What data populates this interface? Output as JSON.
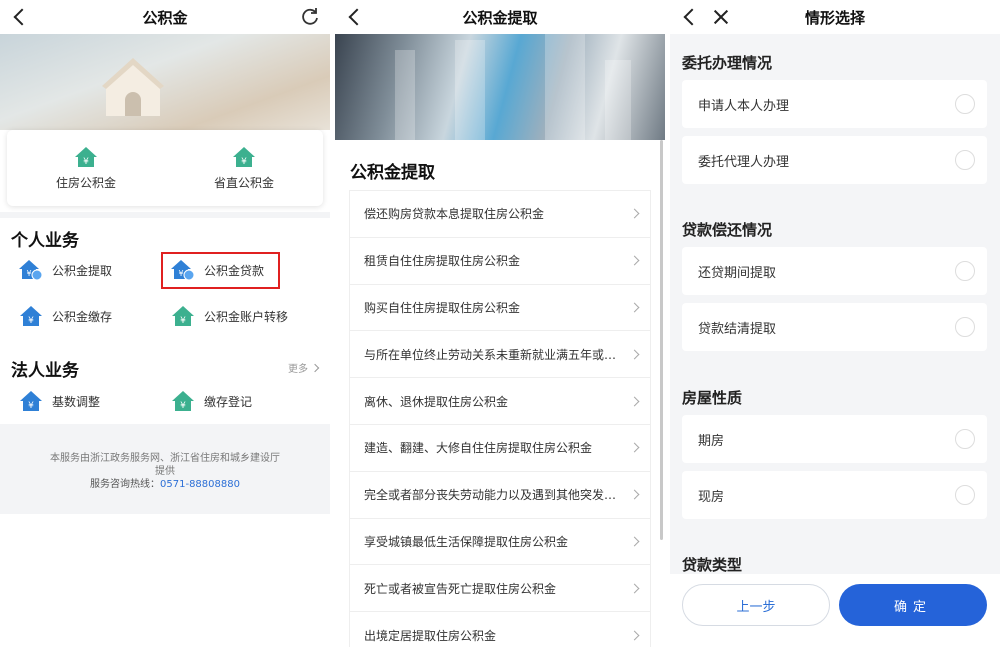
{
  "panel1": {
    "title": "公积金",
    "accounts": [
      "住房公积金",
      "省直公积金"
    ],
    "personal_title": "个人业务",
    "personal_items": [
      "公积金提取",
      "公积金贷款",
      "公积金缴存",
      "公积金账户转移"
    ],
    "corporate_title": "法人业务",
    "more_label": "更多",
    "corporate_items": [
      "基数调整",
      "缴存登记"
    ],
    "footer_line1": "本服务由浙江政务服务网、浙江省住房和城乡建设厅",
    "footer_line2": "提供",
    "hotline_label": "服务咨询热线：",
    "hotline_number": "0571-88808880",
    "icon_color": "#3cb08f",
    "icon_color_alt": "#2f80d6"
  },
  "panel2": {
    "title": "公积金提取",
    "section_title": "公积金提取",
    "items": [
      "偿还购房贷款本息提取住房公积金",
      "租赁自住住房提取住房公积金",
      "购买自住住房提取住房公积金",
      "与所在单位终止劳动关系未重新就业满五年或…",
      "离休、退休提取住房公积金",
      "建造、翻建、大修自住住房提取住房公积金",
      "完全或者部分丧失劳动能力以及遇到其他突发…",
      "享受城镇最低生活保障提取住房公积金",
      "死亡或者被宣告死亡提取住房公积金",
      "出境定居提取住房公积金"
    ]
  },
  "panel3": {
    "title": "情形选择",
    "groups": [
      {
        "title": "委托办理情况",
        "options": [
          "申请人本人办理",
          "委托代理人办理"
        ]
      },
      {
        "title": "贷款偿还情况",
        "options": [
          "还贷期间提取",
          "贷款结清提取"
        ]
      },
      {
        "title": "房屋性质",
        "options": [
          "期房",
          "现房"
        ]
      },
      {
        "title": "贷款类型",
        "options": []
      }
    ],
    "prev_label": "上一步",
    "ok_label": "确定",
    "primary_color": "#2563d9"
  }
}
